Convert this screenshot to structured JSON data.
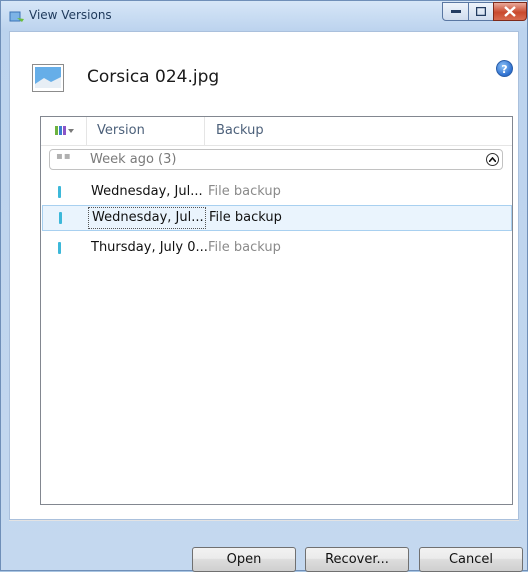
{
  "window": {
    "title": "View Versions",
    "file_name": "Corsica 024.jpg",
    "help_symbol": "?",
    "colors": {
      "accent_marker": "#3db8d9",
      "selection_bg": "#eaf4fd",
      "close_button": "#c9492d"
    }
  },
  "list": {
    "columns": [
      "Version",
      "Backup"
    ],
    "group": {
      "label": "Week ago (3)",
      "collapse_icon": "chevron-up-circle-icon"
    },
    "rows": [
      {
        "version": "Wednesday, Jul...",
        "backup": "File backup",
        "selected": false
      },
      {
        "version": "Wednesday, Jul...",
        "backup": "File backup",
        "selected": true
      },
      {
        "version": "Thursday, July 0...",
        "backup": "File backup",
        "selected": false
      }
    ]
  },
  "buttons": {
    "open": "Open",
    "recover": "Recover...",
    "cancel": "Cancel"
  }
}
